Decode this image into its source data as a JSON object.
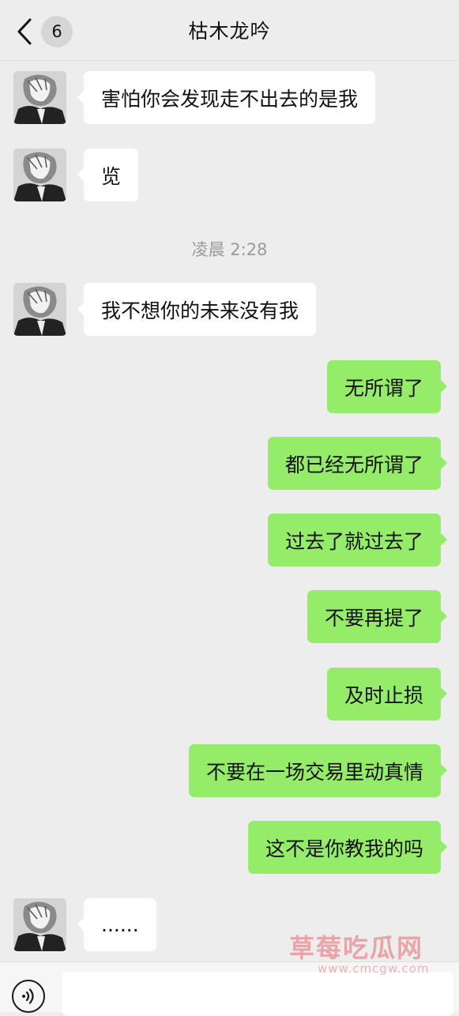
{
  "header": {
    "title": "枯木龙吟",
    "unread_count": "6"
  },
  "messages": [
    {
      "side": "in",
      "text": "害怕你会发现走不出去的是我"
    },
    {
      "side": "in",
      "text": "览"
    },
    {
      "timestamp": "凌晨 2:28"
    },
    {
      "side": "in",
      "text": "我不想你的未来没有我"
    },
    {
      "side": "out",
      "text": "无所谓了"
    },
    {
      "side": "out",
      "text": "都已经无所谓了"
    },
    {
      "side": "out",
      "text": "过去了就过去了"
    },
    {
      "side": "out",
      "text": "不要再提了"
    },
    {
      "side": "out",
      "text": "及时止损"
    },
    {
      "side": "out",
      "text": "不要在一场交易里动真情"
    },
    {
      "side": "out",
      "text": "这不是你教我的吗"
    },
    {
      "side": "in",
      "text": "......"
    }
  ],
  "watermark": {
    "text": "草莓吃瓜网",
    "url": "www.cmcgw.com"
  },
  "input": {
    "value": ""
  },
  "colors": {
    "background": "#ededed",
    "outgoing_bubble": "#95ec69",
    "incoming_bubble": "#ffffff",
    "timestamp_text": "#9a9a9a"
  },
  "icons": {
    "back": "chevron-left-icon",
    "voice": "voice-icon",
    "avatar": "avatar"
  }
}
